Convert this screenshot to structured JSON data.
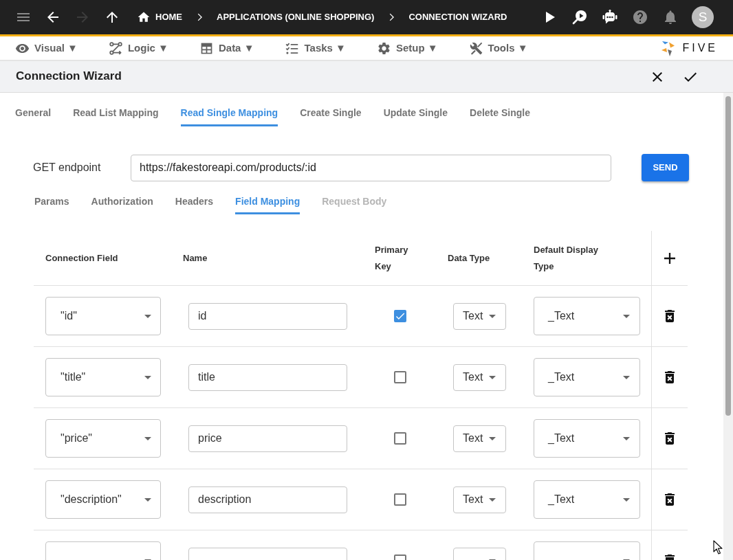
{
  "top_bar": {
    "nav_buttons": [
      {
        "disabled": false
      },
      {
        "disabled": false
      },
      {
        "disabled": true
      },
      {
        "disabled": false
      }
    ],
    "breadcrumbs": [
      {
        "label": "HOME"
      },
      {
        "label": "APPLICATIONS (ONLINE SHOPPING)"
      },
      {
        "label": "CONNECTION WIZARD"
      }
    ],
    "avatar": "S"
  },
  "menu": [
    {
      "label": "Visual ▼"
    },
    {
      "label": "Logic ▼"
    },
    {
      "label": "Data ▼"
    },
    {
      "label": "Tasks ▼"
    },
    {
      "label": "Setup ▼"
    },
    {
      "label": "Tools ▼"
    }
  ],
  "logo": {
    "text": "FIVE"
  },
  "dialog": {
    "title": "Connection Wizard",
    "tabs": [
      {
        "label": "General",
        "selected": false
      },
      {
        "label": "Read List Mapping",
        "selected": false
      },
      {
        "label": "Read Single Mapping",
        "selected": true
      },
      {
        "label": "Create Single",
        "selected": false
      },
      {
        "label": "Update Single",
        "selected": false
      },
      {
        "label": "Delete Single",
        "selected": false
      }
    ],
    "endpoint": {
      "label": "GET endpoint",
      "value": "https://fakestoreapi.com/products/:id"
    },
    "send_button": "SEND",
    "subtabs": [
      {
        "label": "Params",
        "selected": false,
        "disabled": false
      },
      {
        "label": "Authorization",
        "selected": false,
        "disabled": false
      },
      {
        "label": "Headers",
        "selected": false,
        "disabled": false
      },
      {
        "label": "Field Mapping",
        "selected": true,
        "disabled": false
      },
      {
        "label": "Request Body",
        "selected": false,
        "disabled": true
      }
    ],
    "table": {
      "columns": [
        "Connection Field",
        "Name",
        "Primary Key",
        "Data Type",
        "Default Display Type"
      ],
      "rows": [
        {
          "connection_field": "\"id\"",
          "name": "id",
          "primary_key": true,
          "data_type": "Text",
          "display_type": "_Text"
        },
        {
          "connection_field": "\"title\"",
          "name": "title",
          "primary_key": false,
          "data_type": "Text",
          "display_type": "_Text"
        },
        {
          "connection_field": "\"price\"",
          "name": "price",
          "primary_key": false,
          "data_type": "Text",
          "display_type": "_Text"
        },
        {
          "connection_field": "\"description\"",
          "name": "description",
          "primary_key": false,
          "data_type": "Text",
          "display_type": "_Text"
        },
        {
          "primary_key": false
        }
      ]
    }
  }
}
